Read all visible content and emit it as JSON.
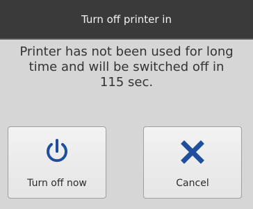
{
  "dialog": {
    "title": "Turn off printer in",
    "message": {
      "line1": "Printer has not been used for long",
      "line2": "time and will be switched off in",
      "line3": "115 sec."
    },
    "buttons": [
      {
        "label": "Turn off now",
        "icon": "power-icon",
        "color": "#1f4e9c"
      },
      {
        "label": "Cancel",
        "icon": "close-icon",
        "color": "#1f4e9c"
      }
    ]
  }
}
